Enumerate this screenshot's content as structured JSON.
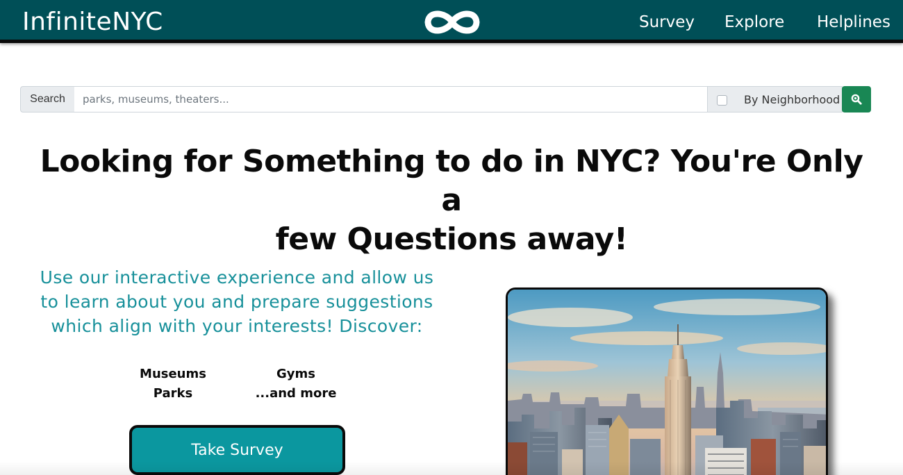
{
  "nav": {
    "brand": "InfiniteNYC",
    "logo_icon": "infinity-icon",
    "links": [
      "Survey",
      "Explore",
      "Helplines"
    ]
  },
  "search": {
    "addon_label": "Search",
    "placeholder": "parks, museums, theaters...",
    "value": "",
    "neighborhood_label": "By Neighborhood",
    "neighborhood_checked": false,
    "button_icon": "search-icon"
  },
  "headline": {
    "line1": "Looking for Something to do in NYC? You're Only a",
    "line2": "few Questions away!"
  },
  "intro": {
    "line1": "Use our interactive experience and allow us",
    "line2": "to learn about you and prepare suggestions",
    "line3": "which align with your interests! Discover:"
  },
  "discover": {
    "col1": [
      "Museums",
      "Parks"
    ],
    "col2": [
      "Gyms",
      "...and more"
    ]
  },
  "cta": {
    "survey_label": "Take Survey"
  },
  "colors": {
    "navbar": "#004f57",
    "accent_text": "#17909a",
    "button": "#0b979f",
    "search_button": "#198754"
  }
}
